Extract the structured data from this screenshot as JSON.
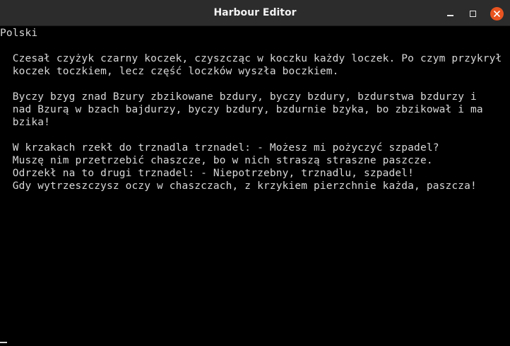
{
  "window": {
    "title": "Harbour Editor"
  },
  "controls": {
    "minimize_icon": "minimize-icon",
    "maximize_icon": "maximize-icon",
    "close_icon": "close-icon",
    "close_color": "#e95420"
  },
  "terminal": {
    "lines": [
      "Polski",
      "",
      "  Czesał czyżyk czarny koczek, czyszcząc w koczku każdy loczek. Po czym przykrył",
      "  koczek toczkiem, lecz część loczków wyszła boczkiem.",
      "",
      "  Byczy bzyg znad Bzury zbzikowane bzdury, byczy bzdury, bzdurstwa bzdurzy i",
      "  nad Bzurą w bzach bajdurzy, byczy bzdury, bzdurnie bzyka, bo zbzikował i ma",
      "  bzika!",
      "",
      "  W krzakach rzekł do trznadla trznadel: - Możesz mi pożyczyć szpadel?",
      "  Muszę nim przetrzebić chaszcze, bo w nich straszą straszne paszcze.",
      "  Odrzekł na to drugi trznadel: - Niepotrzebny, trznadlu, szpadel!",
      "  Gdy wytrzeszczysz oczy w chaszczach, z krzykiem pierzchnie każda, paszcza!"
    ]
  }
}
